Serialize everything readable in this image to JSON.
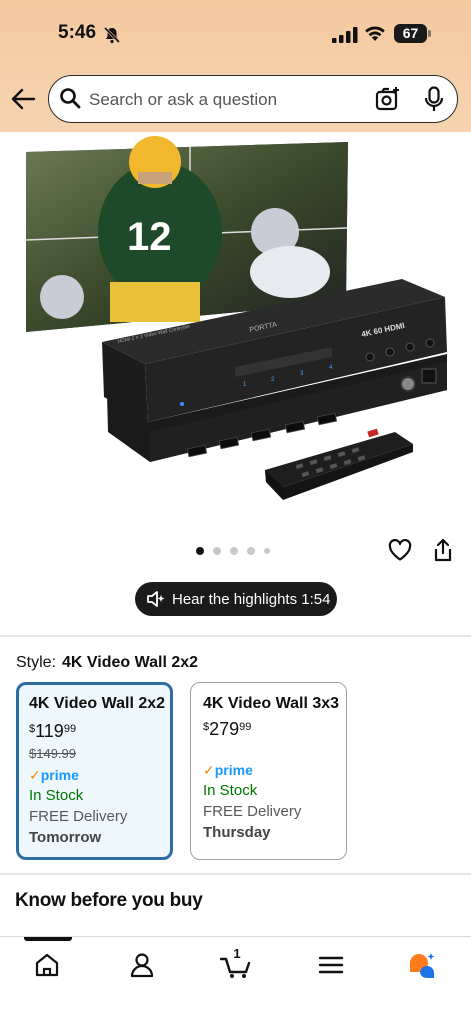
{
  "status_bar": {
    "time": "5:46",
    "battery": "67"
  },
  "search": {
    "placeholder": "Search or ask a question"
  },
  "gallery": {
    "image_count": 5,
    "active_index": 0
  },
  "highlights": {
    "label": "Hear the highlights 1:54"
  },
  "style": {
    "label": "Style:",
    "selected": "4K Video Wall 2x2"
  },
  "options": [
    {
      "title": "4K Video Wall 2x2",
      "price_symbol": "$",
      "price_whole": "119",
      "price_cents": "99",
      "was_price": "$149.99",
      "prime": "prime",
      "stock": "In Stock",
      "delivery": "FREE Delivery",
      "day": "Tomorrow"
    },
    {
      "title": "4K Video Wall 3x3",
      "price_symbol": "$",
      "price_whole": "279",
      "price_cents": "99",
      "prime": "prime",
      "stock": "In Stock",
      "delivery": "FREE Delivery",
      "day": "Thursday"
    }
  ],
  "know_before": {
    "heading": "Know before you buy"
  },
  "product_image": {
    "brand": "PORTTA",
    "device_label": "HDMI 2 X 2 Video Wall Controller",
    "badge": "4K 60 HDMI",
    "player_number": "12",
    "ports": [
      "1",
      "2",
      "3",
      "4"
    ]
  },
  "bottom_nav": {
    "cart_count": "1"
  }
}
